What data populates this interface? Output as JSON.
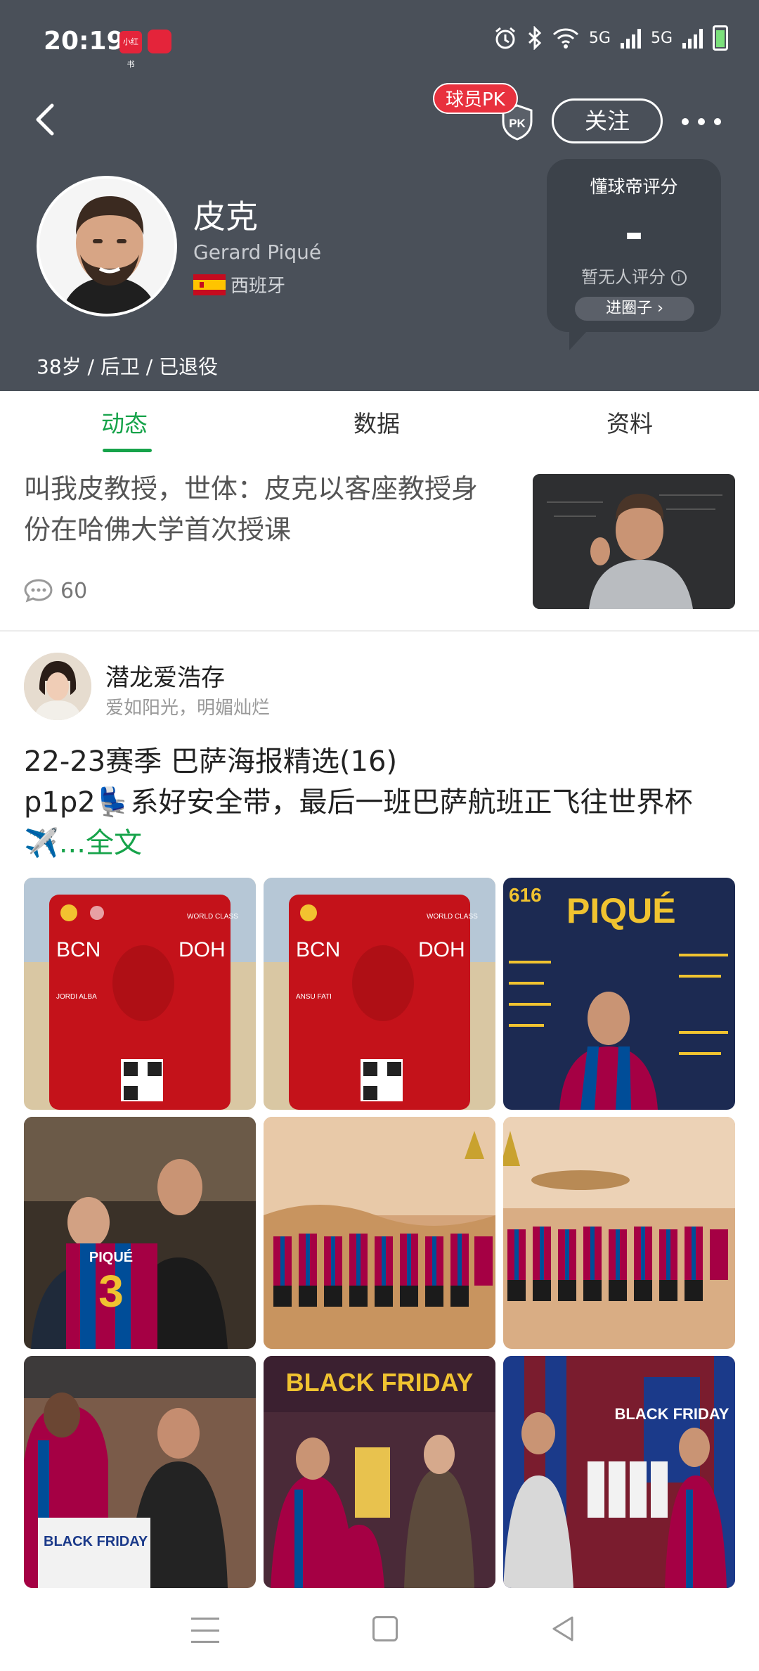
{
  "status_bar": {
    "time": "20:19",
    "app1_label": "小红书",
    "net1": "5G",
    "net2": "5G"
  },
  "header": {
    "pk_label": "球员PK",
    "pk_shield_label": "PK",
    "follow_label": "关注",
    "player": {
      "name": "皮克",
      "english_name": "Gerard Piqué",
      "country": "西班牙",
      "meta": "38岁 / 后卫 / 已退役"
    },
    "rating": {
      "title": "懂球帝评分",
      "score": "-",
      "no_rating": "暂无人评分",
      "button": "进圈子"
    }
  },
  "tabs": [
    {
      "label": "动态",
      "active": true
    },
    {
      "label": "数据",
      "active": false
    },
    {
      "label": "资料",
      "active": false
    }
  ],
  "news": {
    "title": "叫我皮教授，世体：皮克以客座教授身份在哈佛大学首次授课",
    "comments": "60"
  },
  "post": {
    "username": "潜龙爱浩存",
    "signature": "爱如阳光，明媚灿烂",
    "text_line1": "22-23赛季 巴萨海报精选(16)",
    "text_line2": "p1p2💺系好安全带，最后一班巴萨航班正飞往世界杯✈️",
    "more": "...全文",
    "images": [
      {
        "type": "ticket",
        "from": "BCN",
        "to": "DOH",
        "class": "WORLD CLASS",
        "name": "JORDI ALBA"
      },
      {
        "type": "ticket",
        "from": "BCN",
        "to": "DOH",
        "class": "WORLD CLASS",
        "name": "ANSU FATI"
      },
      {
        "type": "poster",
        "title": "PIQUÉ",
        "stat": "616"
      },
      {
        "type": "photo",
        "caption": "PIQUÉ"
      },
      {
        "type": "photo",
        "caption": ""
      },
      {
        "type": "photo",
        "caption": ""
      },
      {
        "type": "photo",
        "caption": "BLACK FRIDAY"
      },
      {
        "type": "photo",
        "caption": "BLACK FRIDAY"
      },
      {
        "type": "photo",
        "caption": "BLACK FRIDAY"
      }
    ]
  },
  "colors": {
    "header_bg": "#4a5059",
    "accent": "#16a34a",
    "pk_red": "#e8313e"
  }
}
